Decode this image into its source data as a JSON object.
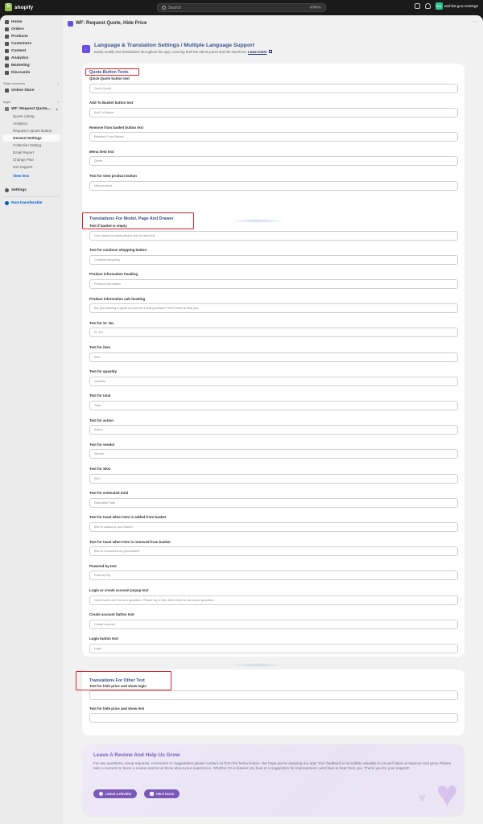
{
  "topbar": {
    "brand": "shopify",
    "search_placeholder": "Search",
    "shortcut": "CTRL K",
    "store_initials": "WG",
    "store_name": "wishlist-guru-testing2"
  },
  "sidebar": {
    "main_items": [
      {
        "label": "Home",
        "icon": "home-icon"
      },
      {
        "label": "Orders",
        "icon": "orders-icon"
      },
      {
        "label": "Products",
        "icon": "products-icon"
      },
      {
        "label": "Customers",
        "icon": "customers-icon"
      },
      {
        "label": "Content",
        "icon": "content-icon"
      },
      {
        "label": "Analytics",
        "icon": "analytics-icon"
      },
      {
        "label": "Marketing",
        "icon": "marketing-icon"
      },
      {
        "label": "Discounts",
        "icon": "discounts-icon"
      }
    ],
    "sales_channels_label": "Sales channels",
    "online_store": "Online Store",
    "apps_label": "Apps",
    "app_name": "WF: Request Quote,...",
    "app_subitems": [
      "Quote Listing",
      "Analytics",
      "Request A Quote Button",
      "General Settings",
      "Collection Setting",
      "Email Report",
      "Change Plan",
      "Get Support"
    ],
    "view_less": "View less",
    "settings": "Settings",
    "non_transferable": "Non-transferable"
  },
  "app_header": {
    "title": "WF: Request Quote, Hide Price",
    "more": "···"
  },
  "page": {
    "back_icon": "arrow-left-icon",
    "title": "Language & Translation Settings / Multiple Language Support",
    "subtitle": "Easily modify text translations throughout the app, covering both the admin panel and the storefront.",
    "learn_more": "Learn more"
  },
  "sections": [
    {
      "title": "Quote Button Texts",
      "fields": [
        {
          "label": "Quick Quote button text",
          "value": "Quick Quote"
        },
        {
          "label": "Add To Basket button text",
          "value": "Add To Basket"
        },
        {
          "label": "Remove from basket button text",
          "value": "Remove From Basket"
        },
        {
          "label": "Menu item text",
          "value": "Quote"
        },
        {
          "label": "Text for view product button",
          "value": "View product"
        }
      ]
    },
    {
      "title": "Translations For Model, Page And Drawer",
      "fields": [
        {
          "label": "Text if basket is empty",
          "value": "Your basket is empty please add an item first"
        },
        {
          "label": "Text for continue shopping button",
          "value": "Continue shopping"
        },
        {
          "label": "Product information heading",
          "value": "Product Information"
        },
        {
          "label": "Product information sub heading",
          "value": "Are you seeking a quote or price for a bulk purchase? We're here to help you."
        },
        {
          "label": "Text for Sr. No.",
          "value": "Sr. No."
        },
        {
          "label": "Text for item",
          "value": "Item"
        },
        {
          "label": "Text for quantity",
          "value": "Quantity"
        },
        {
          "label": "Text for total",
          "value": "Total"
        },
        {
          "label": "Text for action",
          "value": "Action"
        },
        {
          "label": "Text for vendor",
          "value": "Vendor"
        },
        {
          "label": "Text for SKU",
          "value": "SKU"
        },
        {
          "label": "Text for estimated total",
          "value": "Estimated Total"
        },
        {
          "label": "Text for toast when item is added from basket",
          "value": "Item is added to your basket"
        },
        {
          "label": "Text for toast when item is removed from basket",
          "value": "Item is removed from your basket"
        },
        {
          "label": "Powered by text",
          "value": "Powered By"
        },
        {
          "label": "Login or create account popup text",
          "value": "Guest users can't send a quotation. Please log in first, then return to send your quotation."
        },
        {
          "label": "Create account button text",
          "value": "Create account"
        },
        {
          "label": "Login button text",
          "value": "Login"
        }
      ]
    },
    {
      "title": "Translations For Other Text",
      "fields": [
        {
          "label": "Text for hide price and show login",
          "value": ""
        },
        {
          "label": "Text for hide price and show text",
          "value": ""
        }
      ]
    }
  ],
  "review": {
    "title": "Leave A Review And Help Us Grow",
    "text": "For any questions, setup requests, comments or suggestions please contact us from the below button. We hope you're enjoying our app! Your feedback is incredibly valuable to us and helps us improve and grow. Please take a moment to leave a review and let us know about your experience. Whether it's a feature you love or a suggestion for improvement, we'd love to hear from you. Thank you for your support!",
    "leave_review": "LEAVE A REVIEW",
    "help_docs": "HELP DOCS"
  },
  "colors": {
    "accent": "#6b4de6",
    "title_blue": "#35508f",
    "highlight_red": "#e0242a",
    "review_purple": "#7c59b8"
  }
}
